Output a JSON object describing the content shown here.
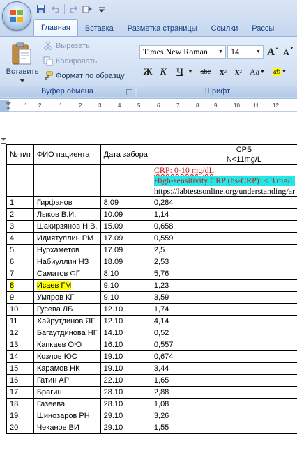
{
  "quick_access": {
    "items": [
      "save-icon",
      "undo-icon",
      "redo-icon",
      "repeat-icon",
      "customize-icon"
    ]
  },
  "tabs": [
    {
      "label": "Главная",
      "active": true
    },
    {
      "label": "Вставка",
      "active": false
    },
    {
      "label": "Разметка страницы",
      "active": false
    },
    {
      "label": "Ссылки",
      "active": false
    },
    {
      "label": "Рассы",
      "active": false
    }
  ],
  "ribbon": {
    "clipboard": {
      "paste_label": "Вставить",
      "cut_label": "Вырезать",
      "copy_label": "Копировать",
      "format_painter_label": "Формат по образцу",
      "group_label": "Буфер обмена"
    },
    "font": {
      "font_name": "Times New Roman",
      "font_size": "14",
      "grow_label": "A",
      "shrink_label": "A",
      "bold_label": "Ж",
      "italic_label": "К",
      "underline_label": "Ч",
      "strike_label": "abe",
      "subscript_label": "x",
      "superscript_label": "x",
      "case_label": "Aa",
      "highlight_label": "ab",
      "group_label": "Шрифт"
    }
  },
  "ruler": {
    "numbers": [
      "1",
      "2",
      "1",
      "2",
      "3",
      "4",
      "5",
      "6",
      "7",
      "8",
      "9",
      "10",
      "11",
      "12"
    ]
  },
  "table": {
    "headers": {
      "num": "№ п/п",
      "name": "ФИО пациента",
      "date": "Дата забора",
      "crp": "СРБ",
      "crp_norm": "N<11mg/L"
    },
    "note": {
      "crp": "CRP: 0-10 mg/dL",
      "hs_crp": "High-sensitivity CRP (hs-CRP): < 3 mg/L",
      "url": "https://labtestsonline.org/understanding/ar"
    },
    "rows": [
      {
        "n": "1",
        "name": "Гирфанов",
        "date": "8.09",
        "value": "0,284"
      },
      {
        "n": "2",
        "name": "Лыков В.И.",
        "date": "10.09",
        "value": "1,14"
      },
      {
        "n": "3",
        "name": "Шакирзянов Н.В.",
        "date": "15.09",
        "value": "0,658"
      },
      {
        "n": "4",
        "name": "Идиятуллин РМ",
        "date": "17.09",
        "value": "0,559"
      },
      {
        "n": "5",
        "name": "Нурхаметов",
        "date": "17.09",
        "value": "2,5"
      },
      {
        "n": "6",
        "name": "Набиуллин НЗ",
        "date": "18.09",
        "value": "2,53"
      },
      {
        "n": "7",
        "name": "Саматов ФГ",
        "date": "8.10",
        "value": "5,76"
      },
      {
        "n": "8",
        "name": "Исаев ГМ",
        "date": "9.10",
        "value": "1,23",
        "highlight": true
      },
      {
        "n": "9",
        "name": "Умяров КГ",
        "date": "9.10",
        "value": "3,59"
      },
      {
        "n": "10",
        "name": "Гусева ЛБ",
        "date": "12.10",
        "value": "1,74"
      },
      {
        "n": "11",
        "name": "Хайрутдинов ЯГ",
        "date": "12.10",
        "value": "4,14"
      },
      {
        "n": "12",
        "name": "Багаутдинова НГ",
        "date": "14.10",
        "value": "0,52"
      },
      {
        "n": "13",
        "name": "Капкаев ОЮ",
        "date": "16.10",
        "value": "0,557"
      },
      {
        "n": "14",
        "name": "Козлов ЮС",
        "date": "19.10",
        "value": "0,674"
      },
      {
        "n": "15",
        "name": "Карамов НК",
        "date": "19.10",
        "value": "3,44"
      },
      {
        "n": "16",
        "name": "Гатин АР",
        "date": "22.10",
        "value": "1,65"
      },
      {
        "n": "17",
        "name": "Брагин",
        "date": "28.10",
        "value": "2,88"
      },
      {
        "n": "18",
        "name": "Газеева",
        "date": "28.10",
        "value": "1,08"
      },
      {
        "n": "19",
        "name": "Шинозаров РН",
        "date": "29.10",
        "value": "3,26"
      },
      {
        "n": "20",
        "name": "Чеканов ВИ",
        "date": "29.10",
        "value": "1,55"
      }
    ]
  },
  "colors": {
    "ribbon_text": "#15428b",
    "crp_text": "#d01818",
    "hs_highlight": "#22e8e8",
    "name_highlight": "#ffff00"
  }
}
